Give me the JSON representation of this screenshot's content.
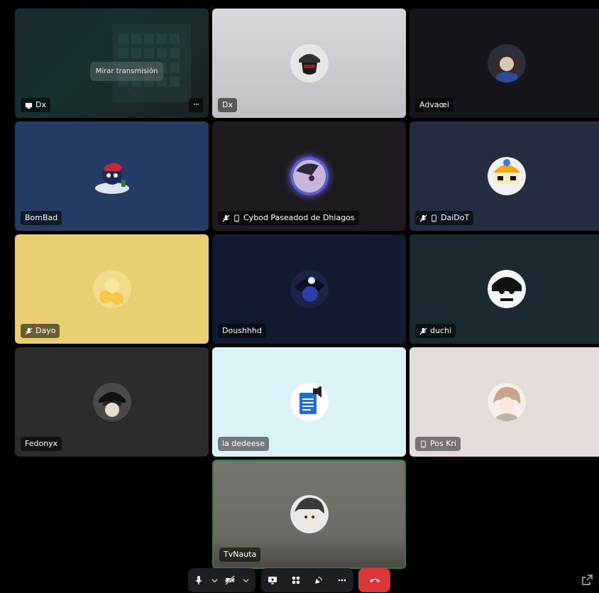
{
  "stream": {
    "watch_label": "Mirar transmisión",
    "name": "Dx",
    "more": "···"
  },
  "tiles": [
    {
      "name": "Dx",
      "bg": "#c9c8cd"
    },
    {
      "name": "Advaœi",
      "bg": "#15161c"
    },
    {
      "name": "BomBad",
      "bg": "#243b63"
    },
    {
      "name": "Cybod Paseadod de Dhiagos",
      "bg": "#1e1a20"
    },
    {
      "name": "DaiDoT",
      "bg": "#232c41"
    },
    {
      "name": "Dayo",
      "bg": "#e9cf72"
    },
    {
      "name": "Doushhhd",
      "bg": "#121a2f"
    },
    {
      "name": "duchi",
      "bg": "#1b2a30"
    },
    {
      "name": "Fedonyx",
      "bg": "#2d2c2a"
    },
    {
      "name": "la dedeese",
      "bg": "#dbf3f6"
    },
    {
      "name": "Pos Kri",
      "bg": "#e3dcd9"
    },
    {
      "name": "TvNauta",
      "bg": "#6e6d66"
    }
  ],
  "toolbar": {
    "icons": [
      "microphone-icon",
      "chevron-down-icon",
      "camera-off-icon",
      "chevron-down-icon",
      "screen-share-icon",
      "activities-icon",
      "soundboard-icon",
      "more-icon",
      "hang-up-icon",
      "pop-out-icon"
    ],
    "hangup_color": "#da373c",
    "more": "···"
  },
  "accent_speaking": "#2f7d3a"
}
